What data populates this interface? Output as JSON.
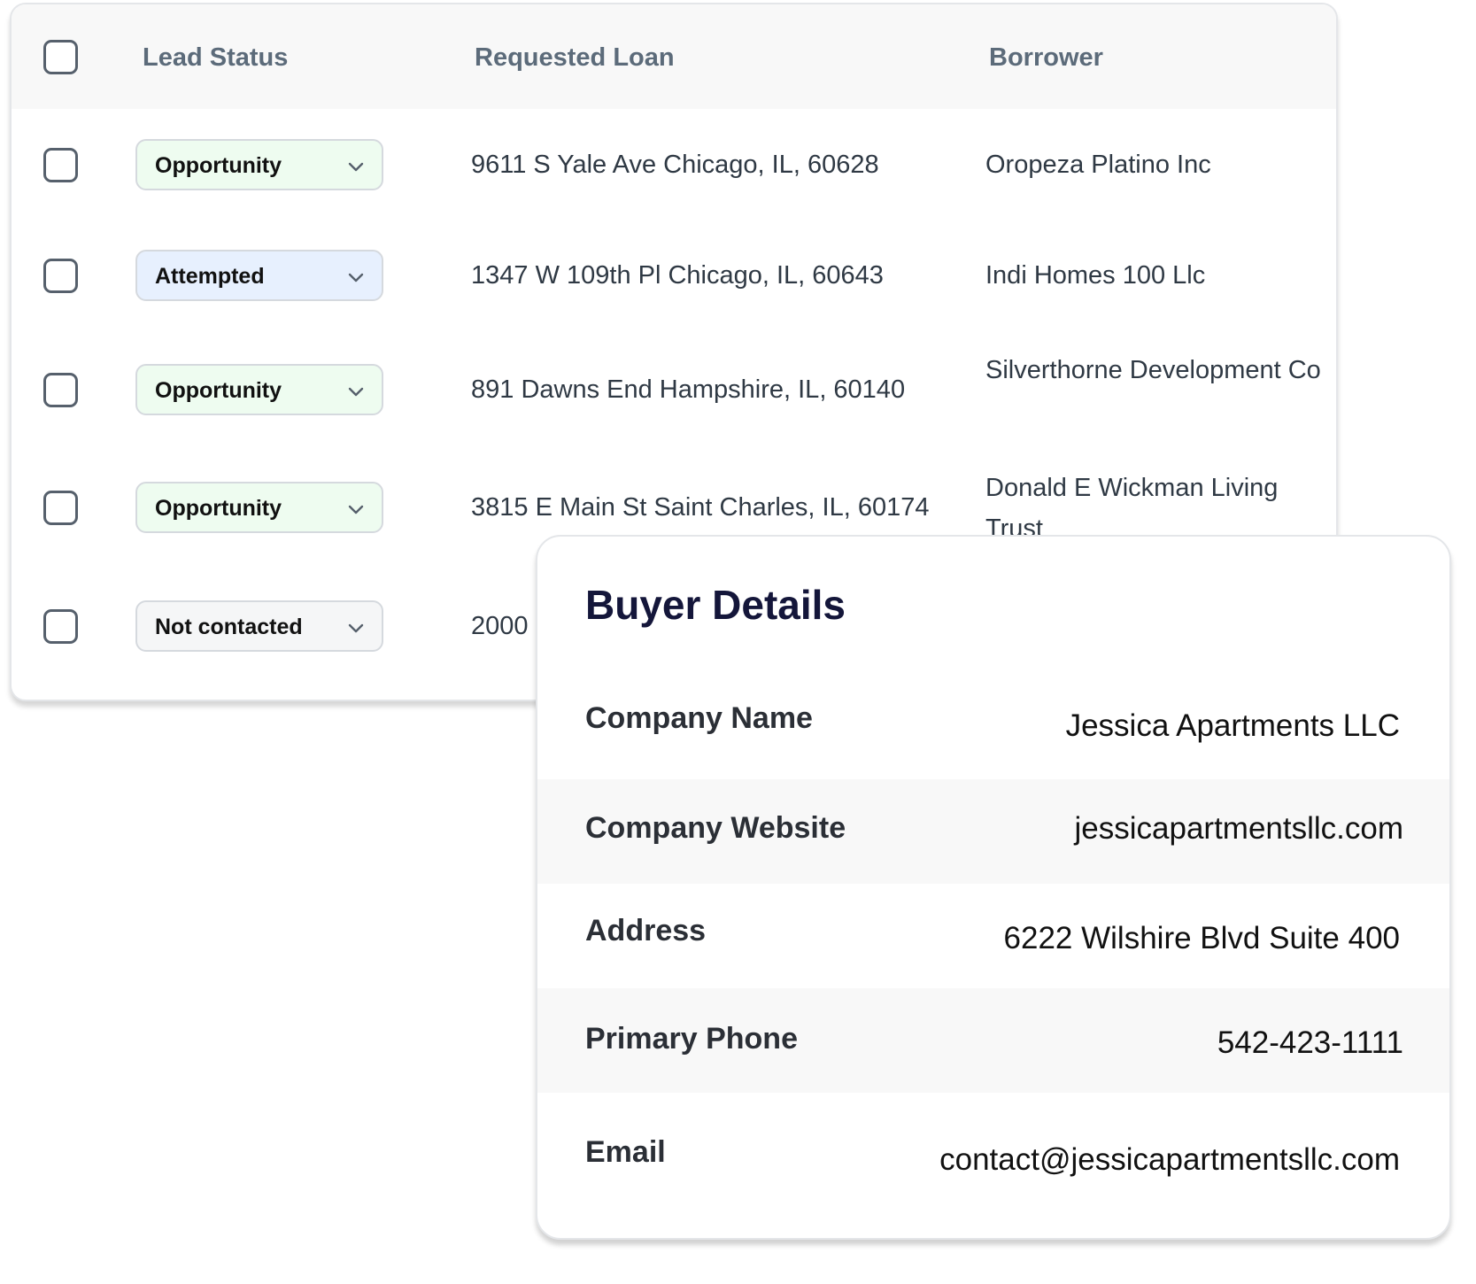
{
  "table": {
    "columns": {
      "lead_status": "Lead Status",
      "requested_loan": "Requested Loan",
      "borrower": "Borrower"
    },
    "rows": [
      {
        "status": "Opportunity",
        "status_color": "#eefcf0",
        "loan": "9611 S Yale Ave Chicago, IL, 60628",
        "borrower": "Oropeza Platino Inc"
      },
      {
        "status": "Attempted",
        "status_color": "#e7f0fe",
        "loan": "1347 W 109th Pl Chicago, IL, 60643",
        "borrower": "Indi Homes 100 Llc"
      },
      {
        "status": "Opportunity",
        "status_color": "#eefcf0",
        "loan": "891 Dawns End Hampshire, IL, 60140",
        "borrower": "Silverthorne Development Co"
      },
      {
        "status": "Opportunity",
        "status_color": "#eefcf0",
        "loan": "3815 E Main St Saint Charles, IL, 60174",
        "borrower": "Donald E Wickman Living Trust"
      },
      {
        "status": "Not contacted",
        "status_color": "#f5f6f7",
        "loan": "2000",
        "borrower": ""
      }
    ]
  },
  "buyer_details": {
    "title": "Buyer Details",
    "fields": [
      {
        "label": "Company Name",
        "value": "Jessica Apartments LLC"
      },
      {
        "label": "Company Website",
        "value": "jessicapartmentsllc.com"
      },
      {
        "label": "Address",
        "value": "6222 Wilshire Blvd Suite 400"
      },
      {
        "label": "Primary Phone",
        "value": "542-423-1111"
      },
      {
        "label": "Email",
        "value": "contact@jessicapartmentsllc.com"
      }
    ]
  },
  "icons": {
    "checkbox": "checkbox-icon",
    "dropdown": "chevron-down-icon"
  }
}
